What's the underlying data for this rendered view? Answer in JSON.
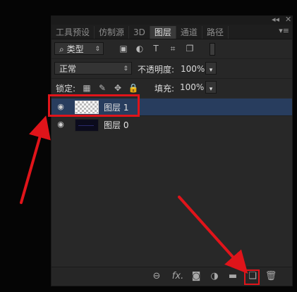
{
  "panel": {
    "top_controls": {
      "collapse": "◂◂",
      "close": "✕"
    },
    "tabs": [
      {
        "label": "工具预设",
        "active": false
      },
      {
        "label": "仿制源",
        "active": false
      },
      {
        "label": "3D",
        "active": false
      },
      {
        "label": "图层",
        "active": true
      },
      {
        "label": "通道",
        "active": false
      },
      {
        "label": "路径",
        "active": false
      }
    ],
    "tab_menu": "▾≡"
  },
  "filter": {
    "kind_icon": "search-icon",
    "kind_label": "类型",
    "icons": [
      "image-filter-icon",
      "adjustment-filter-icon",
      "type-filter-icon",
      "shape-filter-icon",
      "smart-object-filter-icon"
    ]
  },
  "blend": {
    "mode": "正常",
    "opacity_label": "不透明度:",
    "opacity_value": "100%"
  },
  "lock": {
    "label": "锁定:",
    "icons": [
      "lock-transparent-icon",
      "lock-image-icon",
      "lock-position-icon",
      "lock-all-icon"
    ],
    "fill_label": "填充:",
    "fill_value": "100%"
  },
  "layers": [
    {
      "name": "图层 1",
      "visible": true,
      "selected": true,
      "thumb": "transparent"
    },
    {
      "name": "图层 0",
      "visible": true,
      "selected": false,
      "thumb": "dark"
    }
  ],
  "bottom_icons": [
    "link-layers-icon",
    "fx-icon",
    "mask-icon",
    "adjustment-layer-icon",
    "group-folder-icon",
    "new-layer-icon",
    "delete-icon"
  ],
  "bottom_labels": {
    "fx": "fx."
  },
  "colors": {
    "highlight": "#e0141a",
    "selection": "#283d5e",
    "panel_bg": "#272727"
  }
}
